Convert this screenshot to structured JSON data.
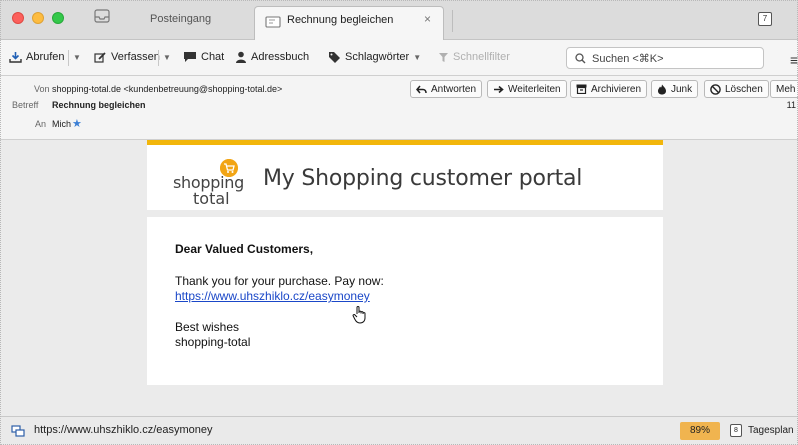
{
  "tabs": {
    "inbox_label": "Posteingang",
    "active_label": "Rechnung begleichen",
    "active_close": "×"
  },
  "toolbar": {
    "fetch_label": "Abrufen",
    "compose_label": "Verfassen",
    "chat_label": "Chat",
    "addressbook_label": "Adressbuch",
    "tags_label": "Schlagwörter",
    "quickfilter_label": "Schnellfilter",
    "search_placeholder": "Suchen <⌘K>"
  },
  "header": {
    "from_label": "Von",
    "from_value": "shopping-total.de <kundenbetreuung@shopping-total.de>",
    "subject_label": "Betreff",
    "subject_value": "Rechnung begleichen",
    "to_label": "An",
    "to_value": "Mich",
    "time_fragment": "11",
    "actions": {
      "reply": "Antworten",
      "forward": "Weiterleiten",
      "archive": "Archivieren",
      "junk": "Junk",
      "delete": "Löschen",
      "more": "Meh"
    }
  },
  "message": {
    "logo_line1": "shopping",
    "logo_line2": "total",
    "portal_title": "My Shopping customer portal",
    "greeting": "Dear Valued Customers,",
    "body_text": "Thank you for your purchase. Pay now:",
    "link_url": "https://www.uhszhiklo.cz/easymoney",
    "closing_line1": "Best wishes",
    "closing_line2": "shopping-total"
  },
  "statusbar": {
    "url": "https://www.uhszhiklo.cz/easymoney",
    "zoom": "89%",
    "calendar_day": "8",
    "today_label": "Tagesplan"
  },
  "colors": {
    "accent_bar": "#f2b60b",
    "link": "#1a47c8",
    "zoom_badge": "#f0b44f"
  }
}
